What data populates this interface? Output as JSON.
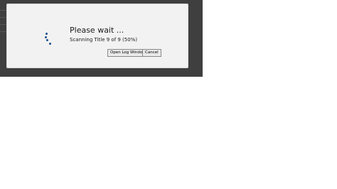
{
  "dialog": {
    "title": "Please wait ...",
    "status": "Scanning Title 9 of 9 (50%)",
    "progress_percent": 50,
    "buttons": {
      "open_log": "Open Log Window",
      "cancel": "Cancel"
    }
  },
  "colors": {
    "backdrop": "#3f3f3f",
    "dialog_bg": "#f2f2f2",
    "spinner": "#1f4e8c"
  },
  "icons": {
    "spinner": "loading-spinner-icon"
  }
}
